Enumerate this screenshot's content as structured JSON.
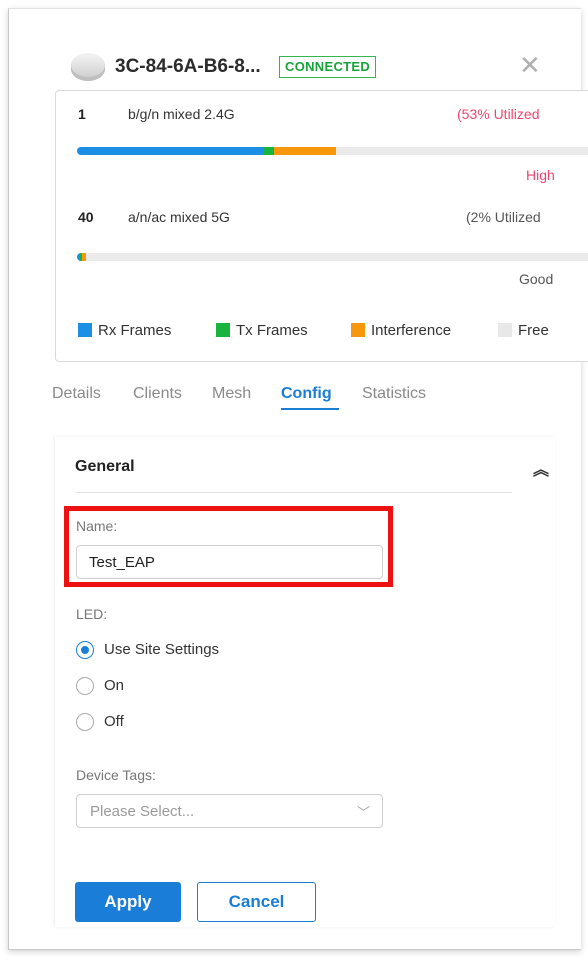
{
  "colors": {
    "accent": "#1a7ed8",
    "connected_green": "#18a33a",
    "util_high_red": "#f0466e",
    "rx_frames": "#1a8fe3",
    "tx_frames": "#19b43d",
    "interference": "#f7980c",
    "free": "#ebebeb",
    "highlight_red": "#ee1111"
  },
  "header": {
    "device_name": "3C-84-6A-B6-8...",
    "status": "CONNECTED",
    "device_icon": "access-point-icon",
    "close_icon": "close-icon"
  },
  "radios": [
    {
      "channel": "1",
      "band": "b/g/n mixed  2.4G",
      "utilization": "(53% Utilized",
      "quality": "High",
      "rx_pct": 36,
      "tx_pct": 2,
      "interference_pct": 12
    },
    {
      "channel": "40",
      "band": "a/n/ac mixed  5G",
      "utilization": "(2% Utilized",
      "quality": "Good",
      "rx_pct": 0.6,
      "tx_pct": 0.2,
      "interference_pct": 0.7
    }
  ],
  "legend": {
    "rx": "Rx Frames",
    "tx": "Tx Frames",
    "interference": "Interference",
    "free": "Free"
  },
  "tabs": [
    "Details",
    "Clients",
    "Mesh",
    "Config",
    "Statistics"
  ],
  "active_tab": "Config",
  "config": {
    "section_title": "General",
    "collapse_icon": "chevron-double-up-icon",
    "name_label": "Name:",
    "name_value": "Test_EAP",
    "led_label": "LED:",
    "led_options": [
      "Use Site Settings",
      "On",
      "Off"
    ],
    "led_selected": "Use Site Settings",
    "device_tags_label": "Device Tags:",
    "device_tags_placeholder": "Please Select...",
    "apply_label": "Apply",
    "cancel_label": "Cancel"
  }
}
